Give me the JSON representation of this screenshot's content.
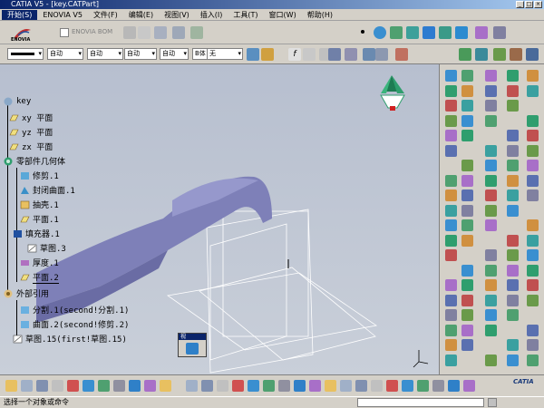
{
  "window": {
    "title": "CATIA V5 - [key.CATPart]",
    "controls": [
      "_",
      "□",
      "×"
    ]
  },
  "menu": {
    "items": [
      "开始(S)",
      "ENOVIA V5",
      "文件(F)",
      "编辑(E)",
      "视图(V)",
      "插入(I)",
      "工具(T)",
      "窗口(W)",
      "帮助(H)"
    ]
  },
  "toolbar": {
    "enovia_logo": "ENOVIA",
    "enovia_label": "ENOVIA BOM",
    "combo_auto1": "自动",
    "combo_auto2": "自动",
    "combo_auto3": "自动",
    "combo_auto4": "自动",
    "combo_font": "B体",
    "combo_none": "无"
  },
  "tree": {
    "root": "key",
    "xy_plane": "xy 平面",
    "yz_plane": "yz 平面",
    "zx_plane": "zx 平面",
    "part_body": "零部件几何体",
    "trim1": "修剪.1",
    "closed_surface1": "封闭曲面.1",
    "shell1": "抽壳.1",
    "plane1": "平面.1",
    "pad1": "填充器.1",
    "sketch3": "草图.3",
    "thickness1": "厚度.1",
    "plane2": "平面.2",
    "external_refs": "外部引用",
    "split1": "分割.1(second!分割.1)",
    "surface2": "曲面.2(second!修剪.2)",
    "sketch15": "草图.15(first!草图.15)"
  },
  "mini_panel": {
    "title": "视"
  },
  "status": {
    "message": "选择一个对象或命令"
  },
  "brand": {
    "catia": "CATIA"
  },
  "colors": {
    "title_bar": "#0a246a",
    "surface": "#7e80b8",
    "viewport_top": "#b7bfcf",
    "viewport_bottom": "#c9cfd9",
    "compass": "#2f9e6e"
  }
}
